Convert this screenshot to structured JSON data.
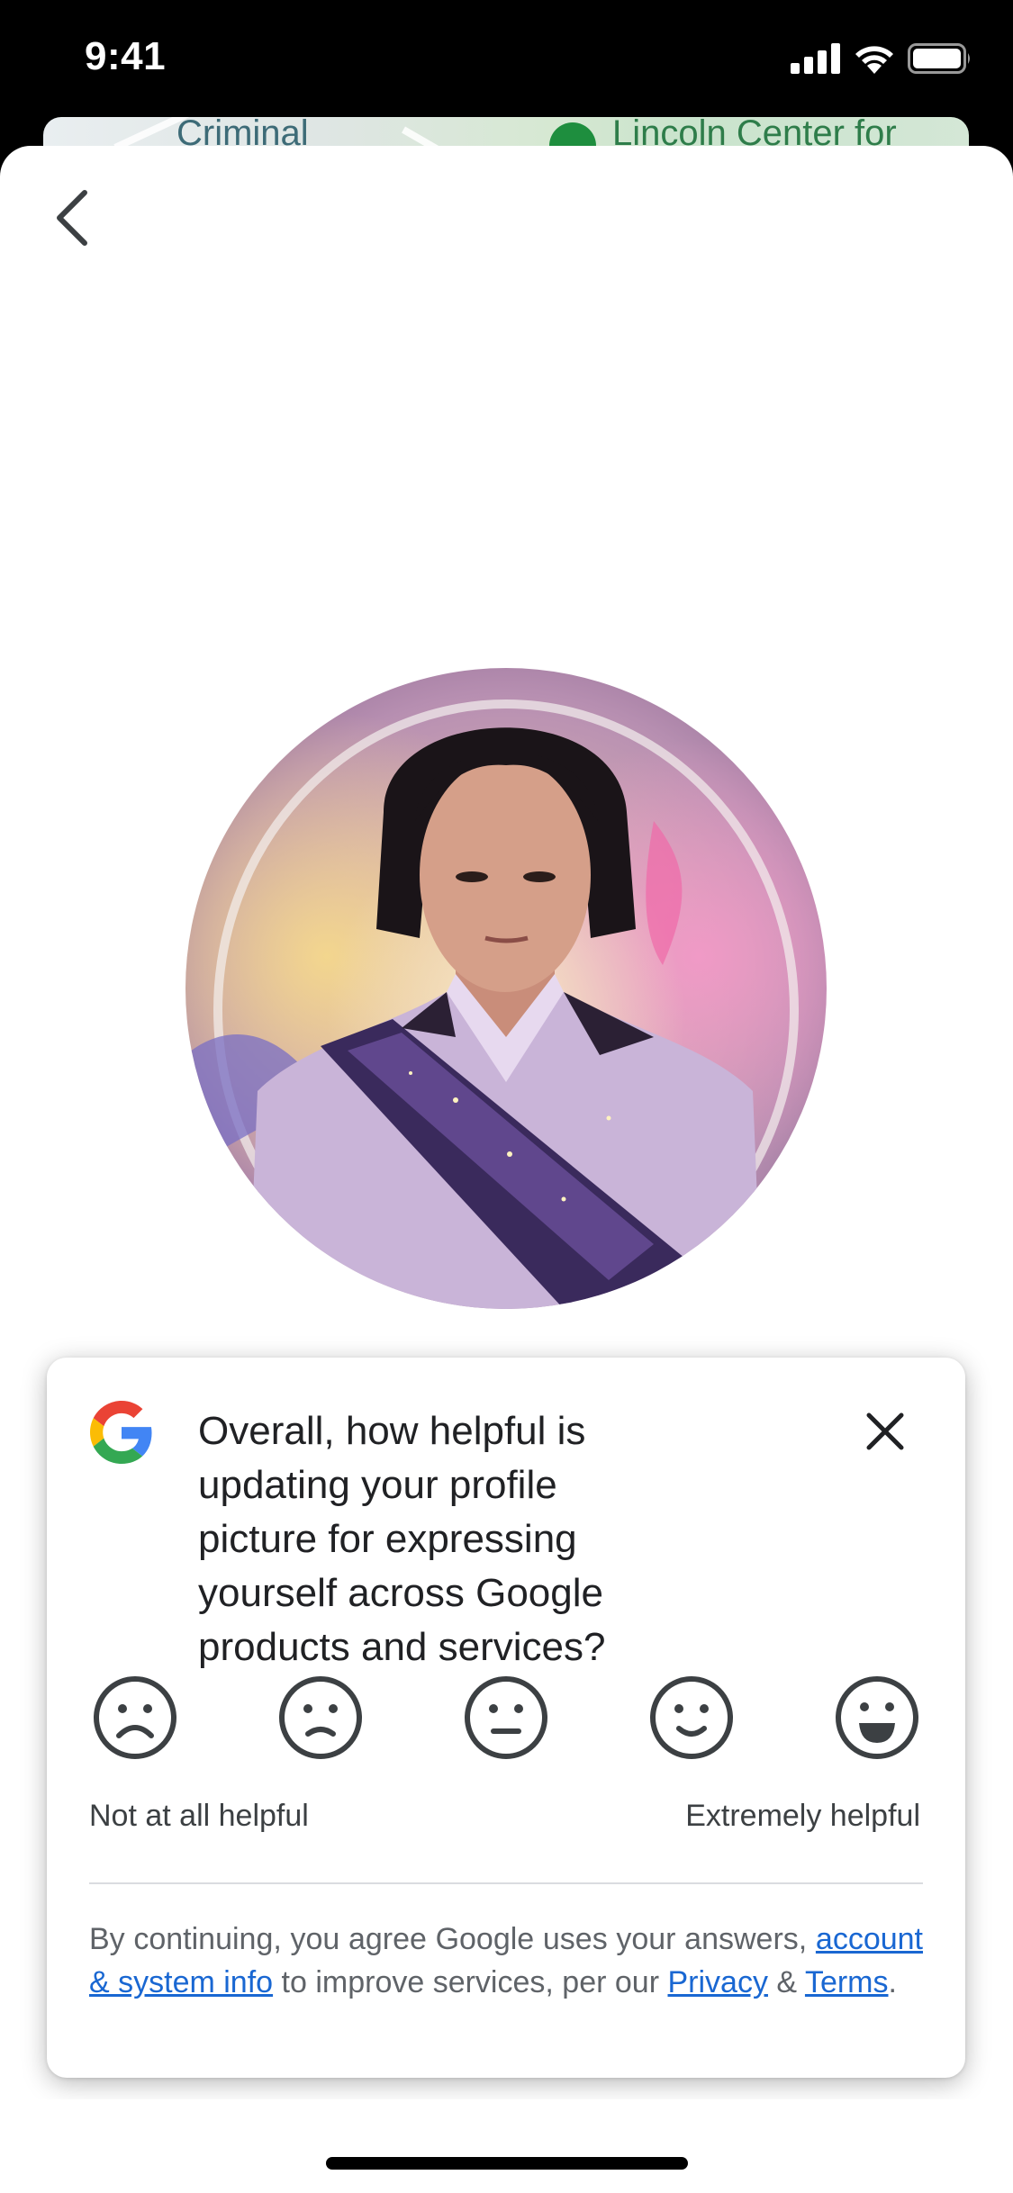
{
  "status_bar": {
    "time": "9:41"
  },
  "map": {
    "label_left": "Criminal",
    "label_right": "Lincoln Center for"
  },
  "feedback": {
    "question": "Overall, how helpful is updating your profile picture for expressing yourself across Google products and services?",
    "scale_low": "Not at all helpful",
    "scale_high": "Extremely helpful",
    "faces": [
      "very-sad-face-icon",
      "sad-face-icon",
      "neutral-face-icon",
      "smile-face-icon",
      "big-smile-face-icon"
    ],
    "disclaimer": {
      "prefix": "By continuing, you agree Google uses your answers,",
      "link_account": "account & system info",
      "middle": "to improve services, per our",
      "link_privacy": "Privacy",
      "amp": "&",
      "link_terms": "Terms",
      "suffix": "."
    }
  },
  "colors": {
    "link": "#1967d2",
    "google_blue": "#4285F4",
    "google_red": "#EA4335",
    "google_yellow": "#FBBC05",
    "google_green": "#34A853"
  }
}
